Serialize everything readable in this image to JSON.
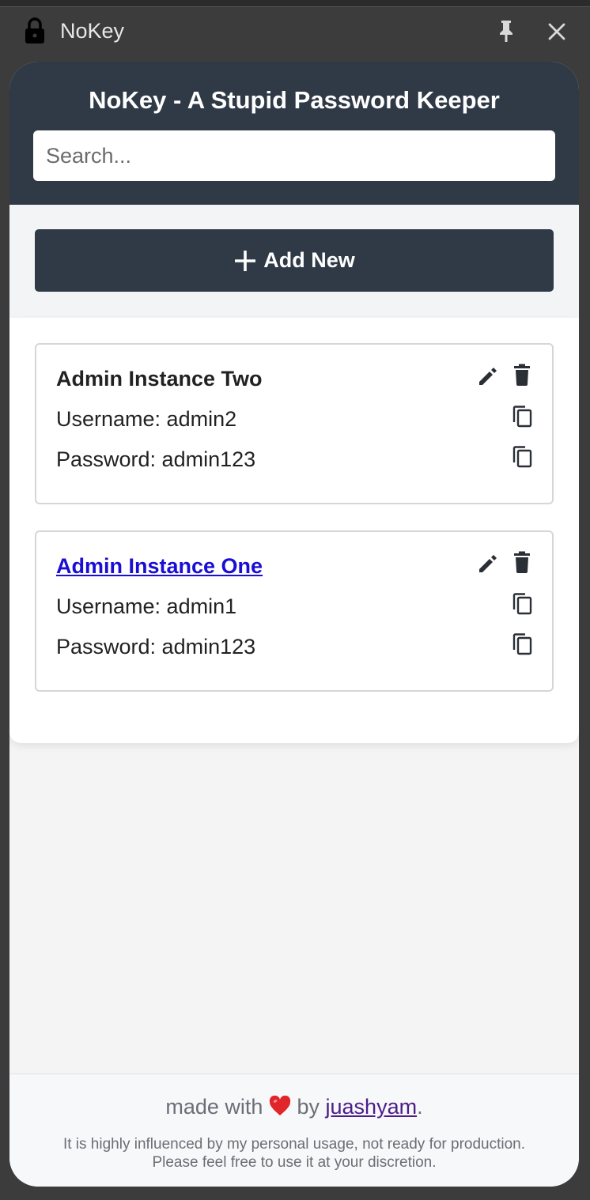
{
  "window": {
    "title": "NoKey"
  },
  "header": {
    "title": "NoKey - A Stupid Password Keeper"
  },
  "search": {
    "placeholder": "Search...",
    "value": ""
  },
  "toolbar": {
    "add_label": "Add New"
  },
  "entries": [
    {
      "title": "Admin Instance Two",
      "is_link": false,
      "username_line": "Username: admin2",
      "password_line": "Password: admin123"
    },
    {
      "title": "Admin Instance One",
      "is_link": true,
      "username_line": "Username: admin1",
      "password_line": "Password: admin123"
    }
  ],
  "footer": {
    "made_with": "made with",
    "by": "by",
    "author": "juashyam",
    "period": ".",
    "note_line1": "It is highly influenced by my personal usage, not ready for production.",
    "note_line2": "Please feel free to use it at your discretion."
  },
  "icons": {
    "window": [
      "lock-icon",
      "pin-icon",
      "close-icon"
    ],
    "card": [
      "edit-icon",
      "delete-icon",
      "copy-icon"
    ],
    "footer": [
      "heart-icon"
    ]
  },
  "colors": {
    "header_bg": "#303a47",
    "link": "#1a0dd4",
    "author_link": "#4c1d8a",
    "heart": "#e0262b"
  }
}
